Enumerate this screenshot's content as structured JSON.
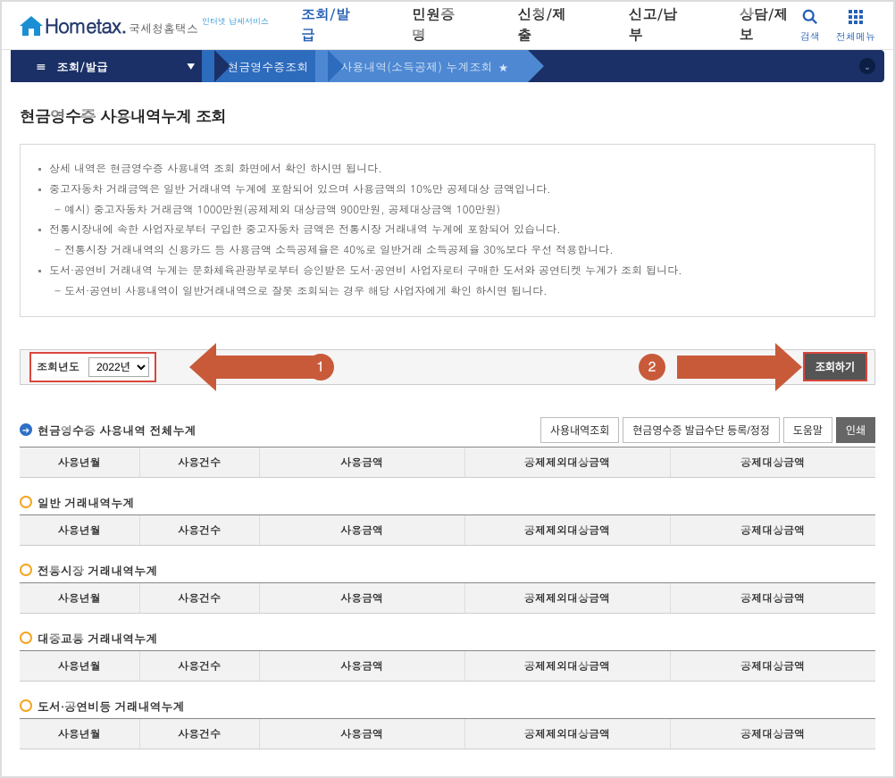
{
  "header": {
    "logo_main": "Hometax.",
    "logo_sub": "국세청홈택스",
    "logo_small": "인터넷 납세서비스",
    "nav": [
      "조회/발급",
      "민원증명",
      "신청/제출",
      "신고/납부",
      "상담/제보"
    ],
    "nav_active_index": 0,
    "search_label": "검색",
    "menu_label": "전체메뉴"
  },
  "crumb": {
    "root": "조회/발급",
    "level2": "현금영수증조회",
    "level3": "사용내역(소득공제) 누계조회"
  },
  "page_title": "현금영수증 사용내역누계 조회",
  "info": [
    {
      "type": "bullet",
      "text": "상세 내역은 현금영수증 사용내역 조회 화면에서 확인 하시면 됩니다."
    },
    {
      "type": "bullet",
      "text": "중고자동차 거래금액은 일반 거래내역 누계에 포함되어 있으며 사용금액의 10%만 공제대상 금액입니다."
    },
    {
      "type": "sub",
      "text": "- 예시) 중고자동차 거래금액 1000만원(공제제외 대상금액 900만원, 공제대상금액 100만원)"
    },
    {
      "type": "bullet",
      "text": "전통시장내에 속한 사업자로부터 구입한 중고자동차 금액은 전통시장 거래내역 누계에 포함되어 있습니다."
    },
    {
      "type": "sub",
      "text": "- 전통시장 거래내역의 신용카드 등 사용금액 소득공제율은 40%로 일반거래 소득공제율 30%보다 우선 적용합니다."
    },
    {
      "type": "bullet",
      "text": "도서·공연비 거래내역 누계는 문화체육관광부로부터 승인받은 도서·공연비 사업자로터 구매한 도서와 공연티켓 누계가 조회 됩니다."
    },
    {
      "type": "sub",
      "text": "- 도서·공연비 사용내역이 일반거래내역으로 잘못 조회되는 경우 해당 사업자에게 확인 하시면 됩니다."
    }
  ],
  "query": {
    "label": "조회년도",
    "year_value": "2022년",
    "btn": "조회하기",
    "badge1": "1",
    "badge2": "2"
  },
  "total_section": {
    "title": "현금영수증 사용내역 전체누계",
    "buttons": {
      "usage": "사용내역조회",
      "register": "현금영수증 발급수단 등록/정정",
      "help": "도움말",
      "print": "인쇄"
    }
  },
  "columns": [
    "사용년월",
    "사용건수",
    "사용금액",
    "공제제외대상금액",
    "공제대상금액"
  ],
  "sub_sections": [
    "일반 거래내역누계",
    "전통시장 거래내역누계",
    "대중교통 거래내역누계",
    "도서·공연비등 거래내역누계"
  ]
}
